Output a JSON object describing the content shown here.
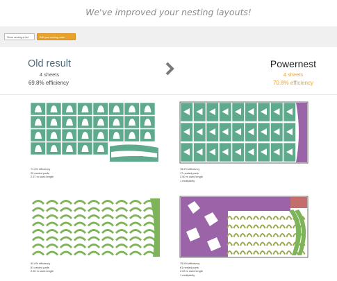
{
  "headline": "We've improved your nesting layouts!",
  "toolbar": {
    "show_button": "Show nesting in list",
    "edit_button": "Edit your nesting order"
  },
  "old": {
    "title": "Old result",
    "sheets": "4 sheets",
    "efficiency": "69.8% efficiency"
  },
  "new": {
    "title": "Powernest",
    "sheets": "4 sheets",
    "efficiency": "70.8% efficiency"
  },
  "layouts": [
    {
      "efficiency": "71.6% efficiency",
      "parts": "20 nested parts",
      "length": "2.37 m used length",
      "multiplicity": ""
    },
    {
      "efficiency": "78.2% efficiency",
      "parts": "17 nested parts",
      "length": "2.50 m used length",
      "multiplicity": "1 multiplicity"
    },
    {
      "efficiency": "54.0% efficiency",
      "parts": "81 nested parts",
      "length": "2.30 m used length",
      "multiplicity": ""
    },
    {
      "efficiency": "75.5% efficiency",
      "parts": "61 nested parts",
      "length": "2.03 m used length",
      "multiplicity": "1 multiplicity"
    }
  ],
  "colors": {
    "teal": "#5faa8c",
    "teal_dark": "#4f9a7e",
    "green": "#7db45a",
    "purple": "#9b63a8",
    "olive": "#9aa64a",
    "accent": "#e8a22b"
  }
}
